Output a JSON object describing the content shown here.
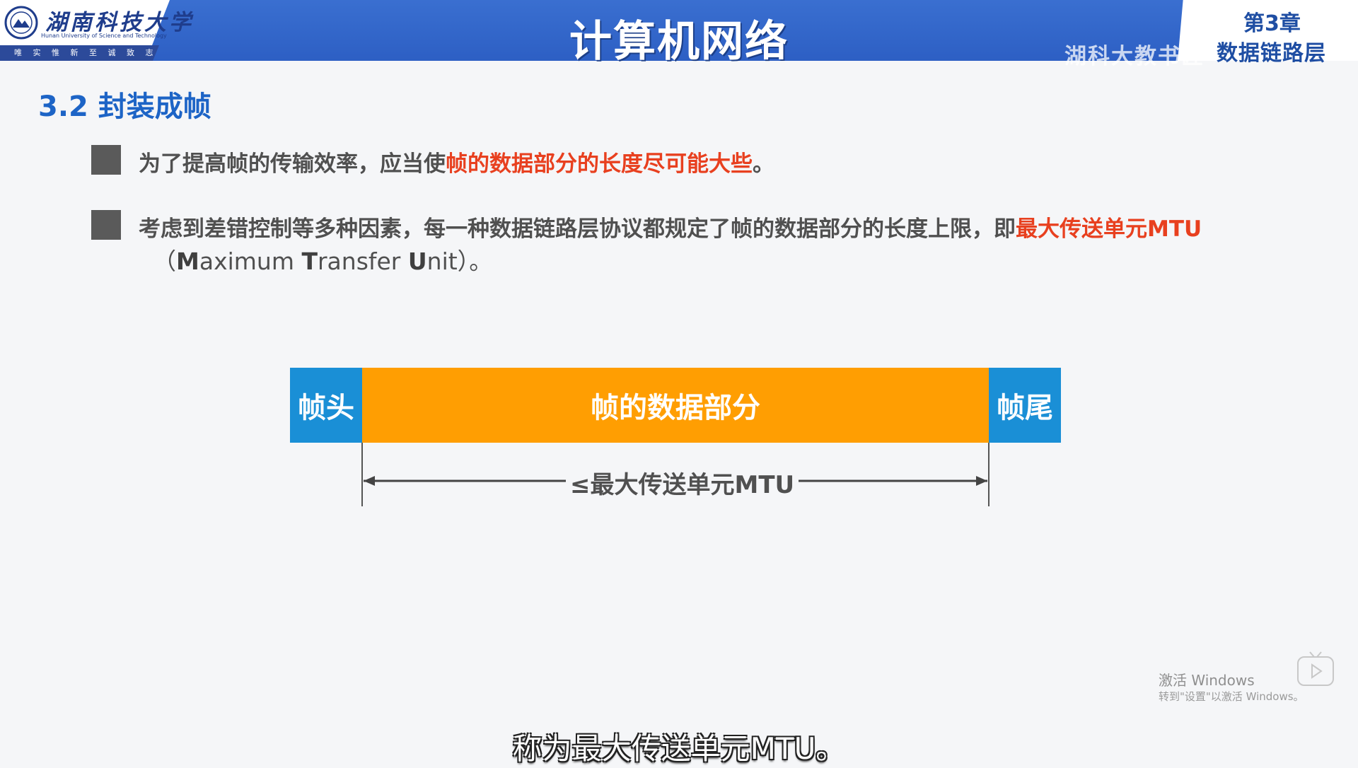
{
  "header": {
    "logo": {
      "name_cn": "湖南科技大学",
      "name_en": "Hunan University of Science and Technology",
      "motto": "唯 实 惟 新    至 诚 致 志"
    },
    "course_title": "计算机网络",
    "watermark": "湖科大教书匠",
    "chapter_number": "第3章",
    "chapter_name": "数据链路层"
  },
  "section": {
    "title": "3.2 封装成帧"
  },
  "bullets": [
    {
      "text_before": "为了提高帧的传输效率，应当使",
      "highlight": "帧的数据部分的长度尽可能大些",
      "text_after": "。"
    },
    {
      "text_before": "考虑到差错控制等多种因素，每一种数据链路层协议都规定了帧的数据部分的长度上限，即",
      "highlight": "最大传送单元MTU",
      "en_open": "（",
      "en_M": "M",
      "en_1": "aximum ",
      "en_T": "T",
      "en_2": "ransfer ",
      "en_U": "U",
      "en_3": "nit）",
      "en_close": "。"
    }
  ],
  "diagram": {
    "header_label": "帧头",
    "data_label": "帧的数据部分",
    "trailer_label": "帧尾",
    "mtu_label": "≤最大传送单元MTU"
  },
  "colors": {
    "header_bar": "#2d5fc4",
    "section_title": "#1d64c6",
    "highlight": "#e8401f",
    "frame_edge": "#1a8fd6",
    "frame_data": "#ff9e02"
  },
  "windows_watermark": {
    "title": "激活 Windows",
    "subtitle": "转到\"设置\"以激活 Windows。"
  },
  "player": {
    "icon": "play-icon"
  },
  "subtitle": "称为最大传送单元MTU。"
}
